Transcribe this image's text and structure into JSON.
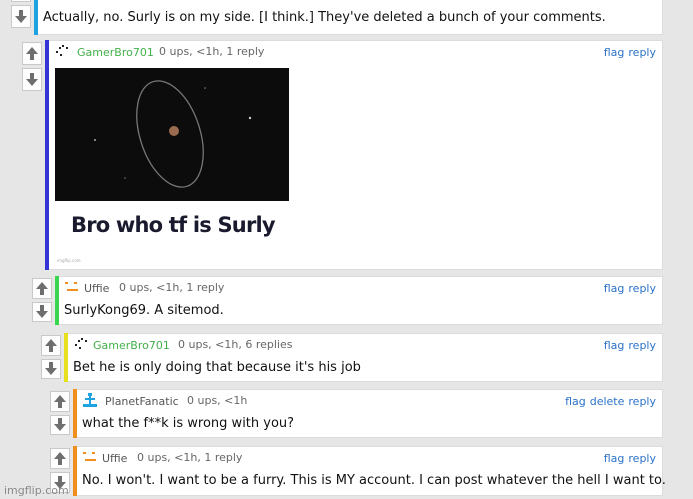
{
  "colors": {
    "blue_bar": "#3433d6",
    "cyan_bar": "#1fa3e0",
    "green_bar": "#39d64f",
    "yellow_bar": "#e6e01e",
    "orange_bar": "#f08e1e",
    "link": "#2b72c9",
    "green_user": "#43b14b"
  },
  "comments": [
    {
      "text": "Actually, no. Surly is on my side. [I think.] They've deleted a bunch of your comments."
    },
    {
      "user": "GamerBro701",
      "meta": "0 ups, <1h, 1 reply",
      "actions": [
        "flag",
        "reply"
      ],
      "image": {
        "caption": "Bro who tf is Surly",
        "small_mark": "imgflip.com"
      }
    },
    {
      "user": "Uffie",
      "meta": "0 ups, <1h, 1 reply",
      "actions": [
        "flag",
        "reply"
      ],
      "text": "SurlyKong69. A sitemod."
    },
    {
      "user": "GamerBro701",
      "meta": "0 ups, <1h, 6 replies",
      "actions": [
        "flag",
        "reply"
      ],
      "text": "Bet he is only doing that because it's his job"
    },
    {
      "user": "PlanetFanatic",
      "meta": "0 ups, <1h",
      "actions": [
        "flag",
        "delete",
        "reply"
      ],
      "text": "what the f**k is wrong with you?"
    },
    {
      "user": "Uffie",
      "meta": "0 ups, <1h, 1 reply",
      "actions": [
        "flag",
        "reply"
      ],
      "text": "No. I won't. I want to be a furry. This is MY account. I can post whatever the hell I want to."
    }
  ],
  "watermark": "imgflip.com"
}
